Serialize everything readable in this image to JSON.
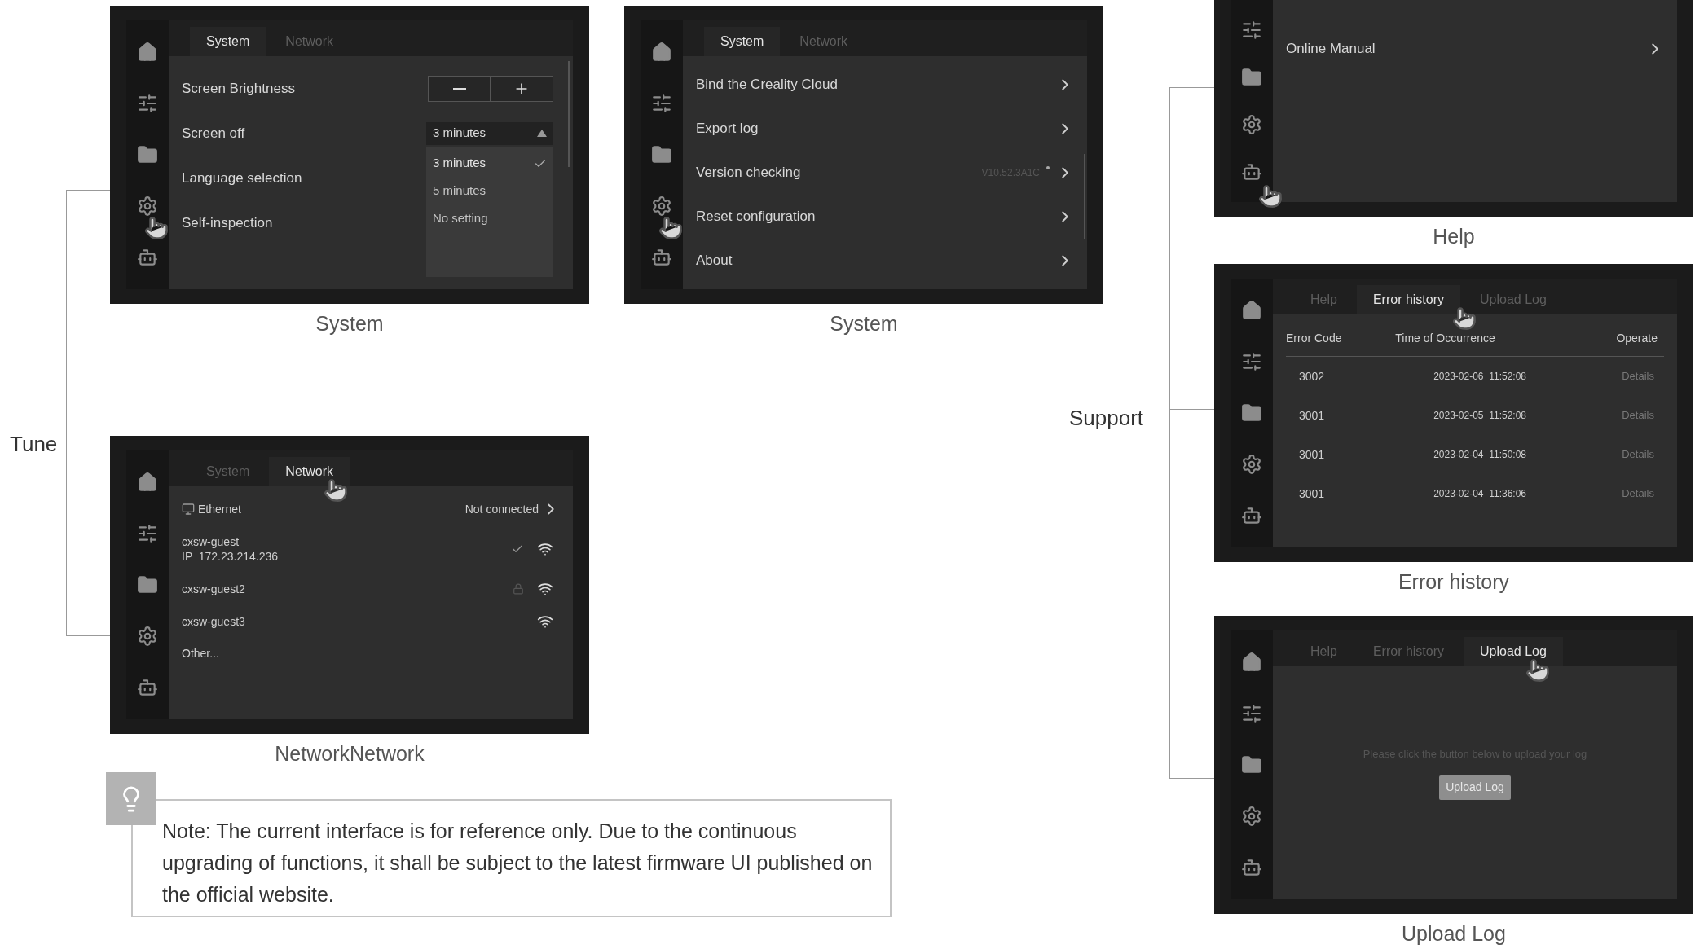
{
  "groups": [
    {
      "label": "Tune"
    },
    {
      "label": "Support"
    }
  ],
  "screens": [
    {
      "kind": "system_settings",
      "caption": "System",
      "tabs": [
        {
          "label": "System",
          "selected": true
        },
        {
          "label": "Network",
          "selected": false
        }
      ],
      "rows": [
        {
          "label": "Screen Brightness",
          "kind": "stepper"
        },
        {
          "label": "Screen off",
          "kind": "dropdown",
          "value": "3 minutes",
          "expanded": true,
          "options": [
            {
              "label": "3 minutes",
              "selected": true
            },
            {
              "label": "5 minutes",
              "selected": false
            },
            {
              "label": "No setting",
              "selected": false
            }
          ]
        },
        {
          "label": "Language selection",
          "kind": "plain"
        },
        {
          "label": "Self-inspection",
          "kind": "plain"
        }
      ]
    },
    {
      "kind": "system_menu",
      "caption": "System",
      "tabs": [
        {
          "label": "System",
          "selected": true
        },
        {
          "label": "Network",
          "selected": false
        }
      ],
      "rows": [
        {
          "label": "Bind the Creality Cloud"
        },
        {
          "label": "Export log"
        },
        {
          "label": "Version checking",
          "value": "V10.52.3A1C",
          "update": true
        },
        {
          "label": "Reset configuration"
        },
        {
          "label": "About"
        }
      ]
    },
    {
      "kind": "network",
      "caption": "NetworkNetwork",
      "tabs": [
        {
          "label": "System",
          "selected": false
        },
        {
          "label": "Network",
          "selected": true
        }
      ],
      "ethernet": {
        "label": "Ethernet",
        "status": "Not connected"
      },
      "networks": [
        {
          "name": "cxsw-guest",
          "ip": "IP  172.23.214.236",
          "connected": true,
          "locked": false
        },
        {
          "name": "cxsw-guest2",
          "connected": false,
          "locked": true
        },
        {
          "name": "cxsw-guest3",
          "connected": false,
          "locked": false
        }
      ],
      "other": "Other..."
    },
    {
      "kind": "help",
      "caption": "Help",
      "rows": [
        {
          "label": "Online Manual"
        }
      ]
    },
    {
      "kind": "error_history",
      "caption": "Error history",
      "tabs": [
        {
          "label": "Help",
          "selected": false
        },
        {
          "label": "Error history",
          "selected": true
        },
        {
          "label": "Upload Log",
          "selected": false
        }
      ],
      "columns": [
        "Error Code",
        "Time of Occurrence",
        "Operate"
      ],
      "rows": [
        [
          "3002",
          "2023-02-06  11:52:08",
          "Details"
        ],
        [
          "3001",
          "2023-02-05  11:52:08",
          "Details"
        ],
        [
          "3001",
          "2023-02-04  11:50:08",
          "Details"
        ],
        [
          "3001",
          "2023-02-04  11:36:06",
          "Details"
        ]
      ]
    },
    {
      "kind": "upload_log",
      "caption": "Upload Log",
      "tabs": [
        {
          "label": "Help",
          "selected": false
        },
        {
          "label": "Error history",
          "selected": false
        },
        {
          "label": "Upload Log",
          "selected": true
        }
      ],
      "message": "Please click the button below to upload your log",
      "button": "Upload Log"
    }
  ],
  "note": "Note: The current interface is for reference only. Due to the continuous upgrading of functions, it shall be subject to the latest firmware UI published on the official website."
}
